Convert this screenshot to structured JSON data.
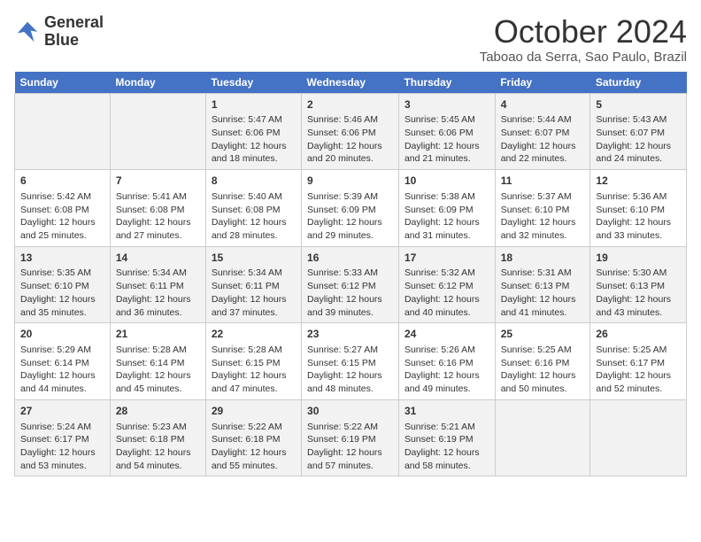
{
  "header": {
    "logo_line1": "General",
    "logo_line2": "Blue",
    "month": "October 2024",
    "location": "Taboao da Serra, Sao Paulo, Brazil"
  },
  "days_of_week": [
    "Sunday",
    "Monday",
    "Tuesday",
    "Wednesday",
    "Thursday",
    "Friday",
    "Saturday"
  ],
  "weeks": [
    [
      {
        "day": "",
        "content": ""
      },
      {
        "day": "",
        "content": ""
      },
      {
        "day": "1",
        "content": "Sunrise: 5:47 AM\nSunset: 6:06 PM\nDaylight: 12 hours and 18 minutes."
      },
      {
        "day": "2",
        "content": "Sunrise: 5:46 AM\nSunset: 6:06 PM\nDaylight: 12 hours and 20 minutes."
      },
      {
        "day": "3",
        "content": "Sunrise: 5:45 AM\nSunset: 6:06 PM\nDaylight: 12 hours and 21 minutes."
      },
      {
        "day": "4",
        "content": "Sunrise: 5:44 AM\nSunset: 6:07 PM\nDaylight: 12 hours and 22 minutes."
      },
      {
        "day": "5",
        "content": "Sunrise: 5:43 AM\nSunset: 6:07 PM\nDaylight: 12 hours and 24 minutes."
      }
    ],
    [
      {
        "day": "6",
        "content": "Sunrise: 5:42 AM\nSunset: 6:08 PM\nDaylight: 12 hours and 25 minutes."
      },
      {
        "day": "7",
        "content": "Sunrise: 5:41 AM\nSunset: 6:08 PM\nDaylight: 12 hours and 27 minutes."
      },
      {
        "day": "8",
        "content": "Sunrise: 5:40 AM\nSunset: 6:08 PM\nDaylight: 12 hours and 28 minutes."
      },
      {
        "day": "9",
        "content": "Sunrise: 5:39 AM\nSunset: 6:09 PM\nDaylight: 12 hours and 29 minutes."
      },
      {
        "day": "10",
        "content": "Sunrise: 5:38 AM\nSunset: 6:09 PM\nDaylight: 12 hours and 31 minutes."
      },
      {
        "day": "11",
        "content": "Sunrise: 5:37 AM\nSunset: 6:10 PM\nDaylight: 12 hours and 32 minutes."
      },
      {
        "day": "12",
        "content": "Sunrise: 5:36 AM\nSunset: 6:10 PM\nDaylight: 12 hours and 33 minutes."
      }
    ],
    [
      {
        "day": "13",
        "content": "Sunrise: 5:35 AM\nSunset: 6:10 PM\nDaylight: 12 hours and 35 minutes."
      },
      {
        "day": "14",
        "content": "Sunrise: 5:34 AM\nSunset: 6:11 PM\nDaylight: 12 hours and 36 minutes."
      },
      {
        "day": "15",
        "content": "Sunrise: 5:34 AM\nSunset: 6:11 PM\nDaylight: 12 hours and 37 minutes."
      },
      {
        "day": "16",
        "content": "Sunrise: 5:33 AM\nSunset: 6:12 PM\nDaylight: 12 hours and 39 minutes."
      },
      {
        "day": "17",
        "content": "Sunrise: 5:32 AM\nSunset: 6:12 PM\nDaylight: 12 hours and 40 minutes."
      },
      {
        "day": "18",
        "content": "Sunrise: 5:31 AM\nSunset: 6:13 PM\nDaylight: 12 hours and 41 minutes."
      },
      {
        "day": "19",
        "content": "Sunrise: 5:30 AM\nSunset: 6:13 PM\nDaylight: 12 hours and 43 minutes."
      }
    ],
    [
      {
        "day": "20",
        "content": "Sunrise: 5:29 AM\nSunset: 6:14 PM\nDaylight: 12 hours and 44 minutes."
      },
      {
        "day": "21",
        "content": "Sunrise: 5:28 AM\nSunset: 6:14 PM\nDaylight: 12 hours and 45 minutes."
      },
      {
        "day": "22",
        "content": "Sunrise: 5:28 AM\nSunset: 6:15 PM\nDaylight: 12 hours and 47 minutes."
      },
      {
        "day": "23",
        "content": "Sunrise: 5:27 AM\nSunset: 6:15 PM\nDaylight: 12 hours and 48 minutes."
      },
      {
        "day": "24",
        "content": "Sunrise: 5:26 AM\nSunset: 6:16 PM\nDaylight: 12 hours and 49 minutes."
      },
      {
        "day": "25",
        "content": "Sunrise: 5:25 AM\nSunset: 6:16 PM\nDaylight: 12 hours and 50 minutes."
      },
      {
        "day": "26",
        "content": "Sunrise: 5:25 AM\nSunset: 6:17 PM\nDaylight: 12 hours and 52 minutes."
      }
    ],
    [
      {
        "day": "27",
        "content": "Sunrise: 5:24 AM\nSunset: 6:17 PM\nDaylight: 12 hours and 53 minutes."
      },
      {
        "day": "28",
        "content": "Sunrise: 5:23 AM\nSunset: 6:18 PM\nDaylight: 12 hours and 54 minutes."
      },
      {
        "day": "29",
        "content": "Sunrise: 5:22 AM\nSunset: 6:18 PM\nDaylight: 12 hours and 55 minutes."
      },
      {
        "day": "30",
        "content": "Sunrise: 5:22 AM\nSunset: 6:19 PM\nDaylight: 12 hours and 57 minutes."
      },
      {
        "day": "31",
        "content": "Sunrise: 5:21 AM\nSunset: 6:19 PM\nDaylight: 12 hours and 58 minutes."
      },
      {
        "day": "",
        "content": ""
      },
      {
        "day": "",
        "content": ""
      }
    ]
  ]
}
